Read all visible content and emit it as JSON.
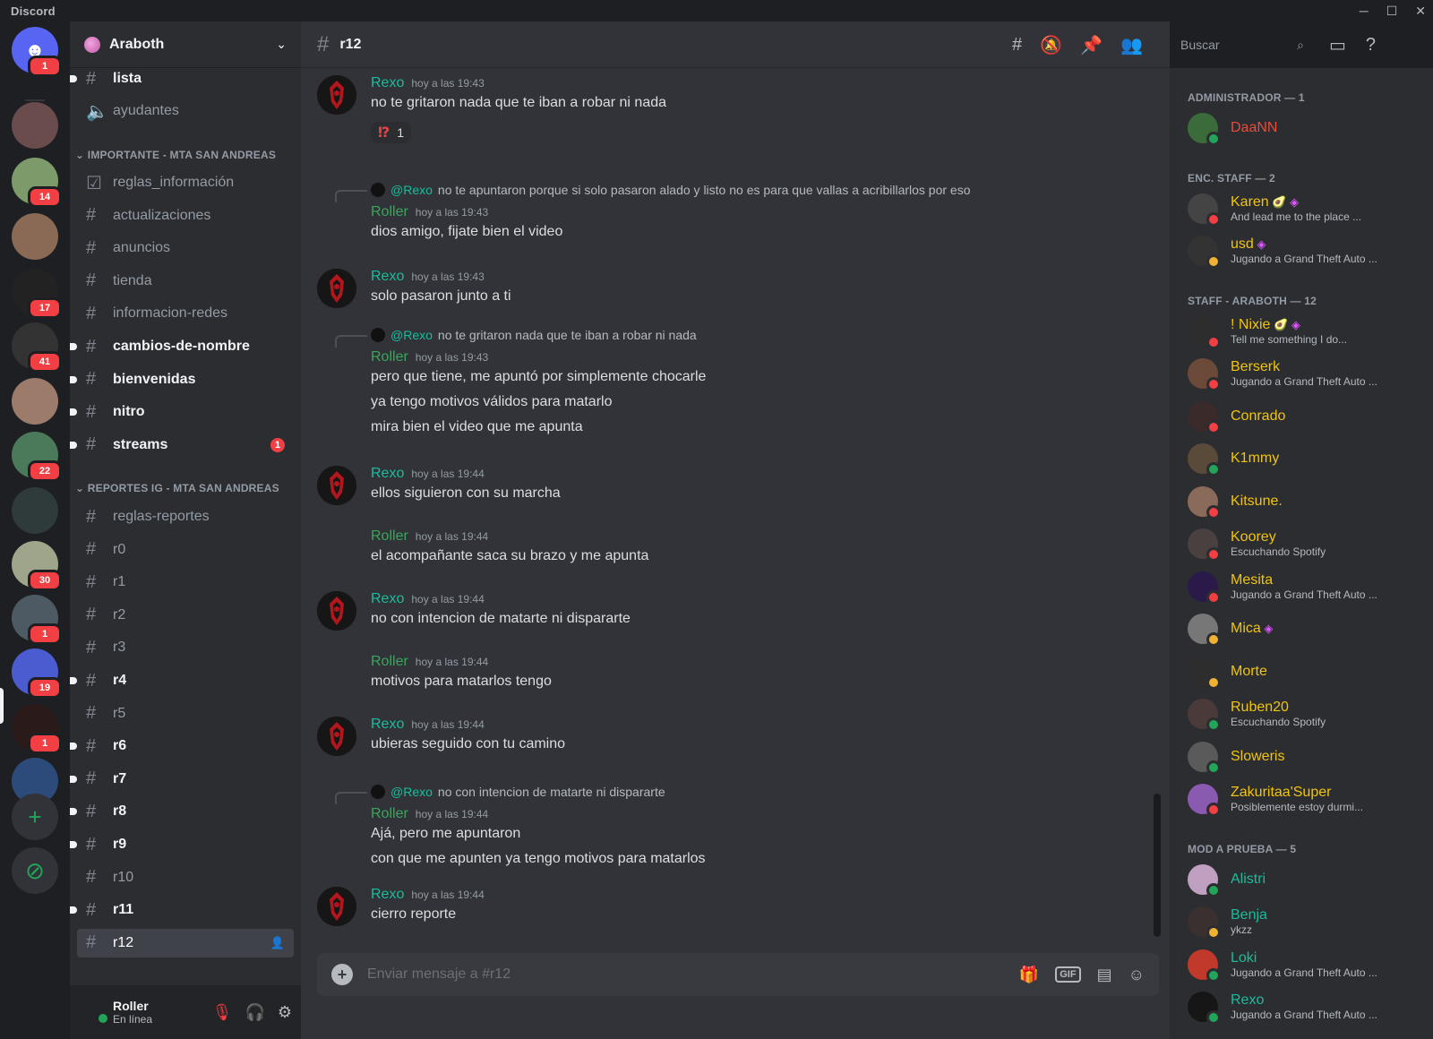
{
  "app": {
    "title": "Discord"
  },
  "servers": [
    {
      "name": "home",
      "badge": "1",
      "color": "#5865f2"
    },
    {
      "name": "server-1",
      "badge": "",
      "color": "#6b4c4c"
    },
    {
      "name": "server-2",
      "badge": "14",
      "color": "#7c9a6a"
    },
    {
      "name": "server-3",
      "badge": "",
      "color": "#8a6a55"
    },
    {
      "name": "server-4",
      "badge": "17",
      "color": "#222222"
    },
    {
      "name": "server-5",
      "badge": "41",
      "color": "#333333"
    },
    {
      "name": "server-6",
      "badge": "",
      "color": "#9c7b6b"
    },
    {
      "name": "server-7",
      "badge": "22",
      "color": "#4a7a5a"
    },
    {
      "name": "server-8",
      "badge": "",
      "color": "#2f3a3a"
    },
    {
      "name": "server-9",
      "badge": "30",
      "color": "#9fa58a"
    },
    {
      "name": "server-10",
      "badge": "1",
      "color": "#4d5a63"
    },
    {
      "name": "server-11",
      "badge": "19",
      "color": "#4b5bd0"
    },
    {
      "name": "server-12",
      "badge": "1",
      "color": "#2a1a1a"
    },
    {
      "name": "server-13",
      "badge": "",
      "color": "#2d4b7a"
    }
  ],
  "guild": {
    "name": "Araboth"
  },
  "channels": {
    "top": [
      {
        "name": "lista",
        "type": "text",
        "unread": true
      },
      {
        "name": "ayudantes",
        "type": "voice",
        "unread": false
      }
    ],
    "cat1": "IMPORTANTE - MTA SAN ANDREAS",
    "group1": [
      {
        "name": "reglas_información",
        "type": "rules",
        "unread": false
      },
      {
        "name": "actualizaciones",
        "unread": false
      },
      {
        "name": "anuncios",
        "unread": false
      },
      {
        "name": "tienda",
        "unread": false
      },
      {
        "name": "informacion-redes",
        "unread": false
      },
      {
        "name": "cambios-de-nombre",
        "unread": true
      },
      {
        "name": "bienvenidas",
        "unread": true
      },
      {
        "name": "nitro",
        "unread": true
      },
      {
        "name": "streams",
        "unread": true,
        "badge": "1"
      }
    ],
    "cat2": "REPORTES IG - MTA SAN ANDREAS",
    "group2": [
      {
        "name": "reglas-reportes",
        "unread": false
      },
      {
        "name": "r0",
        "unread": false
      },
      {
        "name": "r1",
        "unread": false
      },
      {
        "name": "r2",
        "unread": false
      },
      {
        "name": "r3",
        "unread": false
      },
      {
        "name": "r4",
        "unread": true
      },
      {
        "name": "r5",
        "unread": false
      },
      {
        "name": "r6",
        "unread": true
      },
      {
        "name": "r7",
        "unread": true
      },
      {
        "name": "r8",
        "unread": true
      },
      {
        "name": "r9",
        "unread": true
      },
      {
        "name": "r10",
        "unread": false
      },
      {
        "name": "r11",
        "unread": true
      },
      {
        "name": "r12",
        "active": true
      }
    ]
  },
  "user": {
    "name": "Roller",
    "status": "En línea"
  },
  "channel": {
    "name": "r12",
    "composer_placeholder": "Enviar mensaje a #r12"
  },
  "search": {
    "placeholder": "Buscar"
  },
  "messages": [
    {
      "author": "Rexo",
      "time": "hoy a las 19:43",
      "lines": [
        "no te gritaron nada que te iban a robar ni nada"
      ],
      "reaction": {
        "emoji": "⁉",
        "count": "1"
      }
    },
    {
      "author": "Roller",
      "time": "hoy a las 19:43",
      "reply": {
        "mention": "@Rexo",
        "text": "no te apuntaron porque si solo pasaron alado y listo no es para que vallas a acribillarlos por eso"
      },
      "lines": [
        "dios amigo, fijate bien el video"
      ]
    },
    {
      "author": "Rexo",
      "time": "hoy a las 19:43",
      "lines": [
        "solo pasaron junto a ti"
      ]
    },
    {
      "author": "Roller",
      "time": "hoy a las 19:43",
      "reply": {
        "mention": "@Rexo",
        "text": "no te gritaron nada que te iban a robar ni nada"
      },
      "lines": [
        "pero que tiene, me apuntó por simplemente chocarle",
        "ya tengo motivos válidos para matarlo",
        "mira bien el video que me apunta"
      ]
    },
    {
      "author": "Rexo",
      "time": "hoy a las 19:44",
      "lines": [
        "ellos siguieron con su marcha"
      ]
    },
    {
      "author": "Roller",
      "time": "hoy a las 19:44",
      "lines": [
        "el acompañante saca su brazo y me apunta"
      ]
    },
    {
      "author": "Rexo",
      "time": "hoy a las 19:44",
      "lines": [
        "no con intencion de matarte ni dispararte"
      ]
    },
    {
      "author": "Roller",
      "time": "hoy a las 19:44",
      "lines": [
        "motivos para matarlos tengo"
      ]
    },
    {
      "author": "Rexo",
      "time": "hoy a las 19:44",
      "lines": [
        "ubieras seguido con tu camino"
      ]
    },
    {
      "author": "Roller",
      "time": "hoy a las 19:44",
      "reply": {
        "mention": "@Rexo",
        "text": "no con intencion de matarte ni dispararte"
      },
      "lines": [
        "Ajá, pero me apuntaron",
        "con que me apunten ya tengo motivos para matarlos"
      ]
    },
    {
      "author": "Rexo",
      "time": "hoy a las 19:44",
      "lines": [
        "cierro reporte"
      ]
    }
  ],
  "member_groups": [
    {
      "title": "ADMINISTRADOR — 1",
      "members": [
        {
          "name": "DaaNN",
          "color": "red",
          "status": "online",
          "activity": ""
        }
      ]
    },
    {
      "title": "ENC. STAFF — 2",
      "members": [
        {
          "name": "Karen",
          "color": "yellow",
          "status": "dnd",
          "activity": "And lead me to the place ...",
          "icons": "🥑 ◈"
        },
        {
          "name": "usd",
          "color": "yellow",
          "status": "idle",
          "activity": "Jugando a Grand Theft Auto ...",
          "icons": "◈"
        }
      ]
    },
    {
      "title": "STAFF - ARABOTH — 12",
      "members": [
        {
          "name": "! Nixie",
          "color": "yellow",
          "status": "dnd",
          "activity": "Tell me something I do...",
          "icons": "🥑 ◈"
        },
        {
          "name": "Berserk",
          "color": "yellow",
          "status": "dnd",
          "activity": "Jugando a Grand Theft Auto ..."
        },
        {
          "name": "Conrado",
          "color": "yellow",
          "status": "dnd",
          "activity": ""
        },
        {
          "name": "K1mmy",
          "color": "yellow",
          "status": "online",
          "activity": ""
        },
        {
          "name": "Kitsune.",
          "color": "yellow",
          "status": "dnd",
          "activity": ""
        },
        {
          "name": "Koorey",
          "color": "yellow",
          "status": "dnd",
          "activity": "Escuchando Spotify"
        },
        {
          "name": "Mesita",
          "color": "yellow",
          "status": "dnd",
          "activity": "Jugando a Grand Theft Auto ..."
        },
        {
          "name": "Mica",
          "color": "yellow",
          "status": "idle",
          "activity": "",
          "icons": "◈"
        },
        {
          "name": "Morte",
          "color": "yellow",
          "status": "idle",
          "activity": ""
        },
        {
          "name": "Ruben20",
          "color": "yellow",
          "status": "online",
          "activity": "Escuchando Spotify"
        },
        {
          "name": "Sloweris",
          "color": "yellow",
          "status": "online",
          "activity": ""
        },
        {
          "name": "Zakuritaa'Super",
          "color": "yellow",
          "status": "dnd",
          "activity": "Posiblemente estoy durmi..."
        }
      ]
    },
    {
      "title": "MOD A PRUEBA — 5",
      "members": [
        {
          "name": "Alistri",
          "color": "green",
          "status": "online",
          "activity": ""
        },
        {
          "name": "Benja",
          "color": "green",
          "status": "idle",
          "activity": "ykzz"
        },
        {
          "name": "Loki",
          "color": "green",
          "status": "online",
          "activity": "Jugando a Grand Theft Auto ..."
        },
        {
          "name": "Rexo",
          "color": "green",
          "status": "online",
          "activity": "Jugando a Grand Theft Auto ..."
        }
      ]
    }
  ]
}
